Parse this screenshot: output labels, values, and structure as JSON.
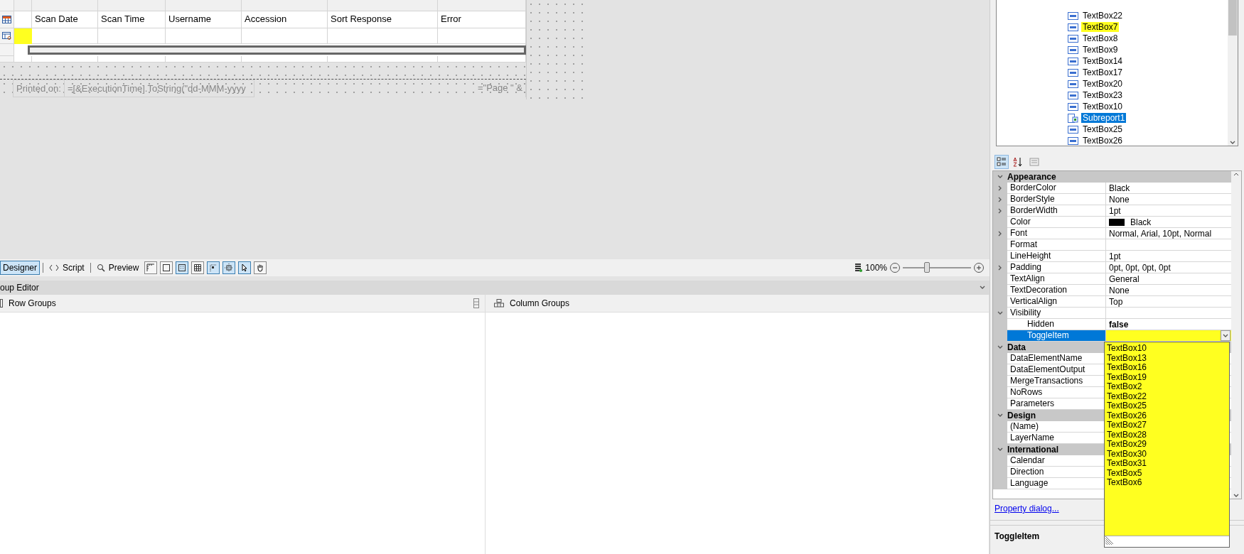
{
  "report": {
    "columns": [
      "Scan Date",
      "Scan Time",
      "Username",
      "Accession",
      "Sort Response",
      "Error"
    ],
    "footer": {
      "label": "Printed on:",
      "expression": "=[&ExecutionTime].ToString(\"dd-MMM-yyyy",
      "page_expression": "=\"Page \" &"
    }
  },
  "designer_tabs": [
    {
      "label": "Designer",
      "selected": true
    },
    {
      "label": "Script",
      "selected": false
    },
    {
      "label": "Preview",
      "selected": false
    }
  ],
  "tools": [
    {
      "kind": "ruler",
      "selected": false
    },
    {
      "kind": "square",
      "selected": false
    },
    {
      "kind": "dots",
      "selected": true
    },
    {
      "kind": "grid",
      "selected": false
    },
    {
      "kind": "snap",
      "selected": true
    },
    {
      "kind": "align",
      "selected": true
    },
    {
      "kind": "pointer",
      "selected": true
    },
    {
      "kind": "hand",
      "selected": false
    }
  ],
  "zoom": {
    "reading": "100%",
    "level": 0.35
  },
  "group_editor": {
    "title": "oup Editor",
    "row_groups": "Row Groups",
    "column_groups": "Column Groups"
  },
  "tree": {
    "items": [
      {
        "label": "TextBox22",
        "kind": "textbox",
        "selected": false
      },
      {
        "label": "TextBox7",
        "kind": "textbox",
        "selected": false
      },
      {
        "label": "TextBox8",
        "kind": "textbox",
        "selected": false
      },
      {
        "label": "TextBox9",
        "kind": "textbox",
        "selected": false
      },
      {
        "label": "TextBox14",
        "kind": "textbox",
        "selected": false
      },
      {
        "label": "TextBox17",
        "kind": "textbox",
        "selected": false
      },
      {
        "label": "TextBox20",
        "kind": "textbox",
        "selected": false
      },
      {
        "label": "TextBox23",
        "kind": "textbox",
        "selected": false
      },
      {
        "label": "TextBox10",
        "kind": "textbox",
        "selected": false
      },
      {
        "label": "Subreport1",
        "kind": "subreport",
        "selected": true
      },
      {
        "label": "TextBox25",
        "kind": "textbox",
        "selected": false
      },
      {
        "label": "TextBox26",
        "kind": "textbox",
        "selected": false
      }
    ]
  },
  "properties": {
    "toolbar": [
      {
        "kind": "categorized",
        "selected": true
      },
      {
        "kind": "alphabetical",
        "selected": false
      },
      {
        "kind": "pages",
        "selected": false
      }
    ],
    "categories": [
      {
        "name": "Appearance",
        "expanded": true,
        "rows": [
          {
            "name": "BorderColor",
            "value": "Black",
            "expandable": true
          },
          {
            "name": "BorderStyle",
            "value": "None",
            "expandable": true
          },
          {
            "name": "BorderWidth",
            "value": "1pt",
            "expandable": true
          },
          {
            "name": "Color",
            "value": "Black",
            "expandable": false,
            "color": "#000000"
          },
          {
            "name": "Font",
            "value": "Normal, Arial, 10pt, Normal",
            "expandable": true
          },
          {
            "name": "Format",
            "expandable": false
          },
          {
            "name": "LineHeight",
            "value": "1pt",
            "expandable": false
          },
          {
            "name": "Padding",
            "value": "0pt, 0pt, 0pt, 0pt",
            "expandable": true
          },
          {
            "name": "TextAlign",
            "value": "General",
            "expandable": false
          },
          {
            "name": "TextDecoration",
            "value": "None",
            "expandable": false
          },
          {
            "name": "VerticalAlign",
            "value": "Top",
            "expandable": false
          },
          {
            "name": "Visibility",
            "expandable": true,
            "expanded": true,
            "children": [
              {
                "name": "Hidden",
                "value": "false",
                "modified": true,
                "selected": false
              },
              {
                "name": "ToggleItem",
                "modified": false,
                "selected": true,
                "dropdown": [
                  "TextBox10",
                  "TextBox13",
                  "TextBox16",
                  "TextBox19",
                  "TextBox2",
                  "TextBox22",
                  "TextBox25",
                  "TextBox26",
                  "TextBox27",
                  "TextBox28",
                  "TextBox29",
                  "TextBox30",
                  "TextBox31",
                  "TextBox5",
                  "TextBox6"
                ]
              }
            ]
          }
        ]
      },
      {
        "name": "Data",
        "expanded": true,
        "rows": [
          {
            "name": "DataElementName",
            "expandable": false
          },
          {
            "name": "DataElementOutput",
            "expandable": false
          },
          {
            "name": "MergeTransactions",
            "expandable": false
          },
          {
            "name": "NoRows",
            "expandable": false
          },
          {
            "name": "Parameters",
            "expandable": false
          }
        ]
      },
      {
        "name": "Design",
        "expanded": true,
        "rows": [
          {
            "name": "(Name)",
            "expandable": false
          },
          {
            "name": "LayerName",
            "expandable": false
          }
        ]
      },
      {
        "name": "International",
        "expanded": true,
        "rows": [
          {
            "name": "Calendar",
            "expandable": false
          },
          {
            "name": "Direction",
            "expandable": false
          },
          {
            "name": "Language",
            "expandable": false
          }
        ]
      }
    ]
  },
  "property_dialog_link": "Property dialog...",
  "description": {
    "title": "ToggleItem"
  }
}
